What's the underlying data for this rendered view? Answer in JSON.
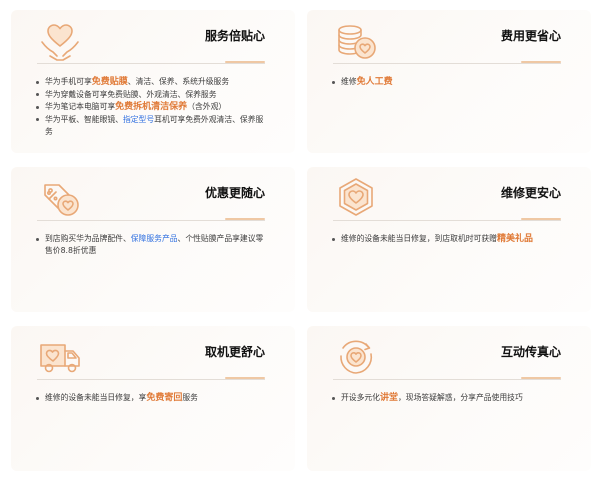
{
  "colors": {
    "accent_orange": "#e07a37",
    "accent_blue": "#2f6fe0",
    "icon_stroke": "#e8a877"
  },
  "cards": [
    {
      "icon": "heart-hands-icon",
      "title": "服务倍贴心",
      "items": [
        {
          "a": "华为手机可享",
          "hl": "免费贴膜",
          "b": "、清洁、保养、系统升级服务"
        },
        {
          "a": "华为穿戴设备可享免费贴膜、外观清洁、保养服务"
        },
        {
          "a": "华为笔记本电脑可享",
          "hl": "免费拆机清洁保养",
          "b": "（含外观）"
        },
        {
          "a": "华为平板、智能眼镜、",
          "link": "指定型号",
          "b": "耳机可享免费外观清洁、保养服务"
        }
      ]
    },
    {
      "icon": "coins-heart-icon",
      "title": "费用更省心",
      "items": [
        {
          "a": "维修",
          "hl": "免人工费"
        }
      ]
    },
    {
      "icon": "discount-tag-heart-icon",
      "title": "优惠更随心",
      "items": [
        {
          "a": "到店购买华为品牌配件、",
          "link": "保障服务产品",
          "b": "、个性贴膜产品享建议零售价8.8折优惠"
        }
      ]
    },
    {
      "icon": "hexagon-heart-icon",
      "title": "维修更安心",
      "items": [
        {
          "a": "维修的设备未能当日修复，到店取机时可获赠",
          "hl": "精美礼品"
        }
      ]
    },
    {
      "icon": "delivery-truck-heart-icon",
      "title": "取机更舒心",
      "items": [
        {
          "a": "维修的设备未能当日修复，享",
          "hl": "免费寄回",
          "b": "服务"
        }
      ]
    },
    {
      "icon": "circle-heart-icon",
      "title": "互动传真心",
      "items": [
        {
          "a": "开设多元化",
          "hl": "讲堂",
          "b": "，现场答疑解惑，分享产品使用技巧"
        }
      ]
    }
  ]
}
